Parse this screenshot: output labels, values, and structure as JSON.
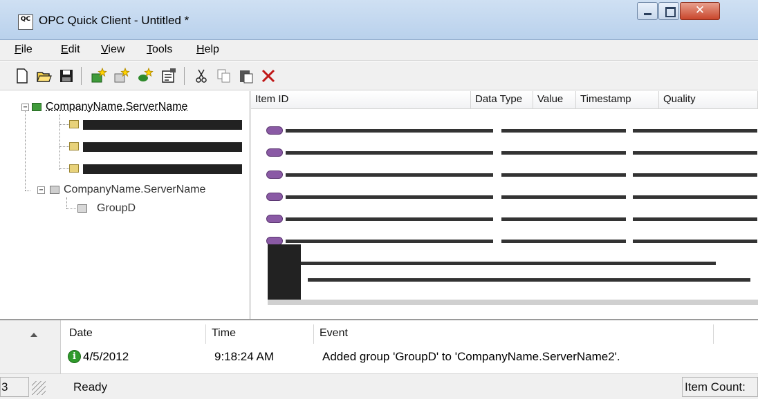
{
  "window": {
    "icon_text": "QC",
    "title": "OPC Quick Client - Untitled *"
  },
  "menu": {
    "items": [
      "File",
      "Edit",
      "View",
      "Tools",
      "Help"
    ]
  },
  "toolbar": {
    "buttons": [
      "new-icon",
      "open-icon",
      "save-icon",
      "new-server-icon",
      "new-group-icon",
      "new-item-icon",
      "properties-icon",
      "cut-icon",
      "copy-icon",
      "paste-icon",
      "delete-icon"
    ]
  },
  "tree": {
    "nodes": [
      {
        "label": "CompanyName.ServerName",
        "expanded": true,
        "type": "server"
      },
      {
        "label": "CompanyName.ServerName",
        "expanded": true,
        "type": "server"
      },
      {
        "label": "GroupD",
        "type": "group"
      }
    ]
  },
  "items_list": {
    "columns": [
      "Item ID",
      "Data Type",
      "Value",
      "Timestamp",
      "Quality"
    ]
  },
  "event_log": {
    "columns": [
      "Date",
      "Time",
      "Event"
    ],
    "rows": [
      {
        "date": "4/5/2012",
        "time": "9:18:24 AM",
        "event": "Added group 'GroupD' to 'CompanyName.ServerName2'.",
        "icon": "info-icon"
      }
    ]
  },
  "status": {
    "text": "Ready",
    "left_panel": "3",
    "item_count_label": "Item Count:"
  },
  "colors": {
    "titlebar": "#c4d9f0",
    "close_button": "#c9462c",
    "server_icon": "#3f9b3a",
    "info_icon": "#2f9a2b"
  }
}
